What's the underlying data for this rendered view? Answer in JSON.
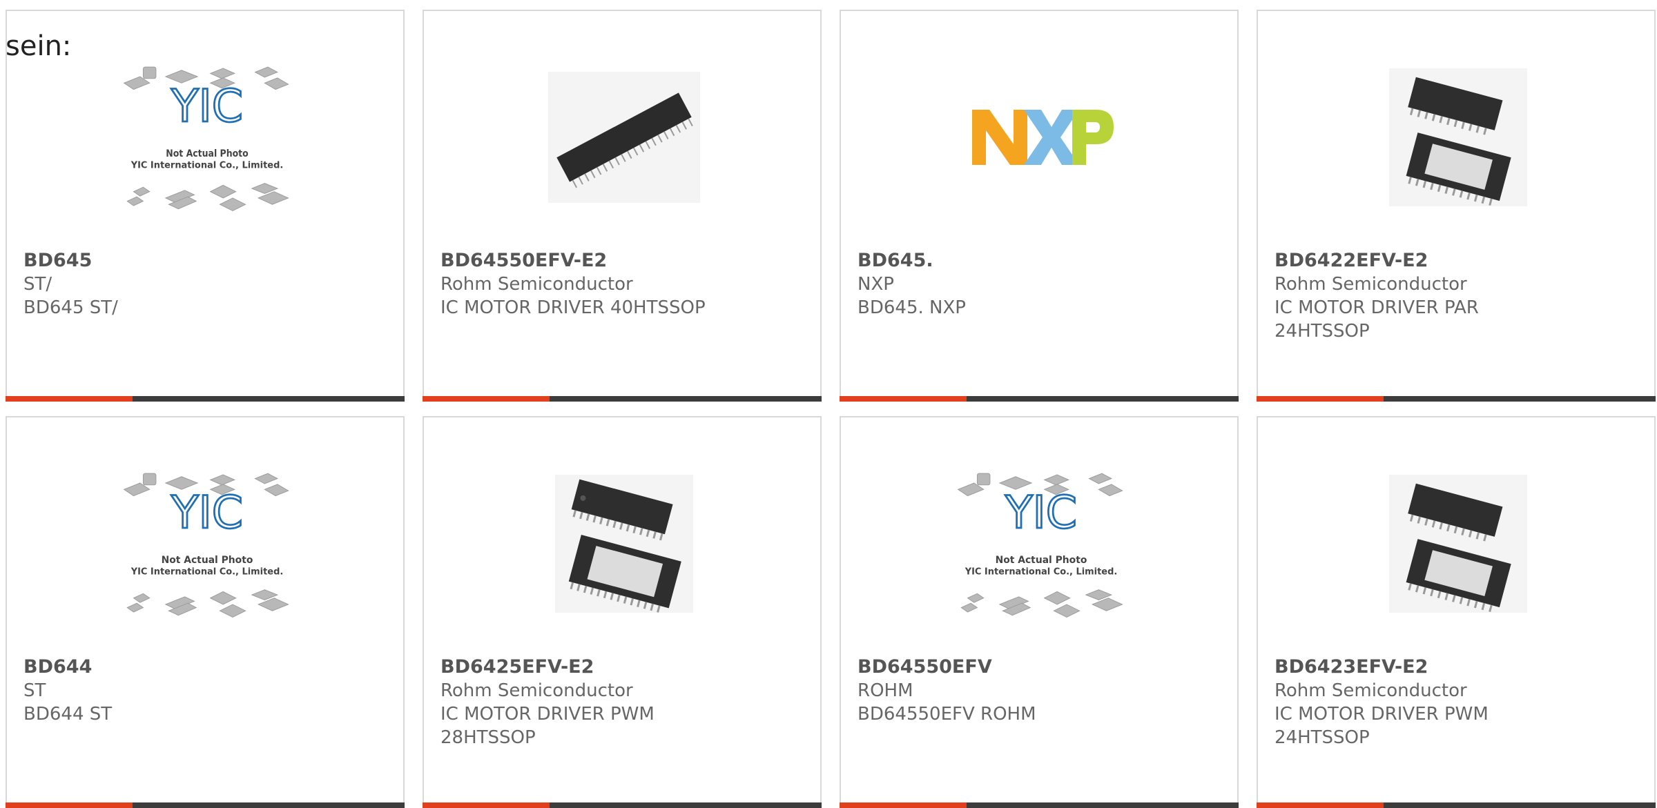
{
  "heading": "sein:",
  "placeholder": {
    "logo": "YIC",
    "line1": "Not Actual Photo",
    "line2": "YIC International Co., Limited."
  },
  "nxp_logo": "NXP",
  "colors": {
    "accent": "#e2401c",
    "bar": "#3c3c3c",
    "yic_blue": "#1f6fb5",
    "nxp_orange": "#f4a41e",
    "nxp_blue": "#7bbbe5",
    "nxp_green": "#b8d33a"
  },
  "products": [
    {
      "part": "BD645",
      "manufacturer": "ST/",
      "description": "BD645 ST/",
      "image": "placeholder"
    },
    {
      "part": "BD64550EFV-E2",
      "manufacturer": "Rohm Semiconductor",
      "description": "IC MOTOR DRIVER 40HTSSOP",
      "image": "chip-htssop-40"
    },
    {
      "part": "BD645.",
      "manufacturer": "NXP",
      "description": "BD645. NXP",
      "image": "nxp-logo"
    },
    {
      "part": "BD6422EFV-E2",
      "manufacturer": "Rohm Semiconductor",
      "description": "IC MOTOR DRIVER PAR 24HTSSOP",
      "image": "chip-htssop-24"
    },
    {
      "part": "BD644",
      "manufacturer": "ST",
      "description": "BD644 ST",
      "image": "placeholder"
    },
    {
      "part": "BD6425EFV-E2",
      "manufacturer": "Rohm Semiconductor",
      "description": "IC MOTOR DRIVER PWM 28HTSSOP",
      "image": "chip-htssop-28"
    },
    {
      "part": "BD64550EFV",
      "manufacturer": "ROHM",
      "description": "BD64550EFV ROHM",
      "image": "placeholder"
    },
    {
      "part": "BD6423EFV-E2",
      "manufacturer": "Rohm Semiconductor",
      "description": "IC MOTOR DRIVER PWM 24HTSSOP",
      "image": "chip-htssop-24"
    }
  ]
}
